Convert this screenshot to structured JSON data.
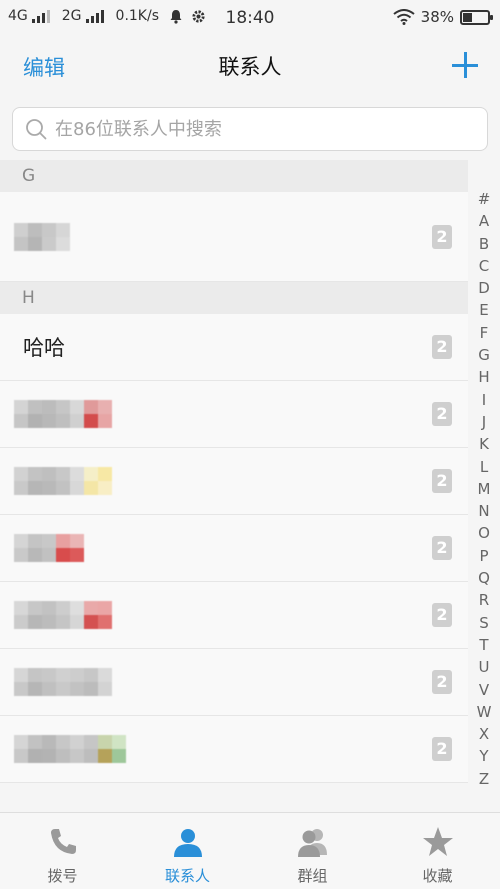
{
  "status_bar": {
    "net1": "4G",
    "net2": "2G",
    "speed": "0.1K/s",
    "time": "18:40",
    "battery": "38%",
    "battery_level": 0.38
  },
  "header": {
    "edit_label": "编辑",
    "title": "联系人"
  },
  "search": {
    "placeholder": "在86位联系人中搜索"
  },
  "sections": [
    {
      "letter": "G",
      "contacts": [
        {
          "name": "",
          "sim": "2"
        }
      ]
    },
    {
      "letter": "H",
      "contacts": [
        {
          "name": "哈哈",
          "sim": "2"
        },
        {
          "name": "",
          "sim": "2"
        },
        {
          "name": "",
          "sim": "2"
        },
        {
          "name": "",
          "sim": "2"
        },
        {
          "name": "",
          "sim": "2"
        },
        {
          "name": "",
          "sim": "2"
        },
        {
          "name": "",
          "sim": "2"
        }
      ]
    }
  ],
  "alphabet": [
    "#",
    "A",
    "B",
    "C",
    "D",
    "E",
    "F",
    "G",
    "H",
    "I",
    "J",
    "K",
    "L",
    "M",
    "N",
    "O",
    "P",
    "Q",
    "R",
    "S",
    "T",
    "U",
    "V",
    "W",
    "X",
    "Y",
    "Z"
  ],
  "bottom_nav": [
    {
      "label": "拨号",
      "icon": "phone-icon"
    },
    {
      "label": "联系人",
      "icon": "person-icon",
      "active": true
    },
    {
      "label": "群组",
      "icon": "group-icon"
    },
    {
      "label": "收藏",
      "icon": "star-icon"
    }
  ],
  "colors": {
    "accent": "#2a8fd8",
    "inactive_icon": "#9a9a9a"
  }
}
